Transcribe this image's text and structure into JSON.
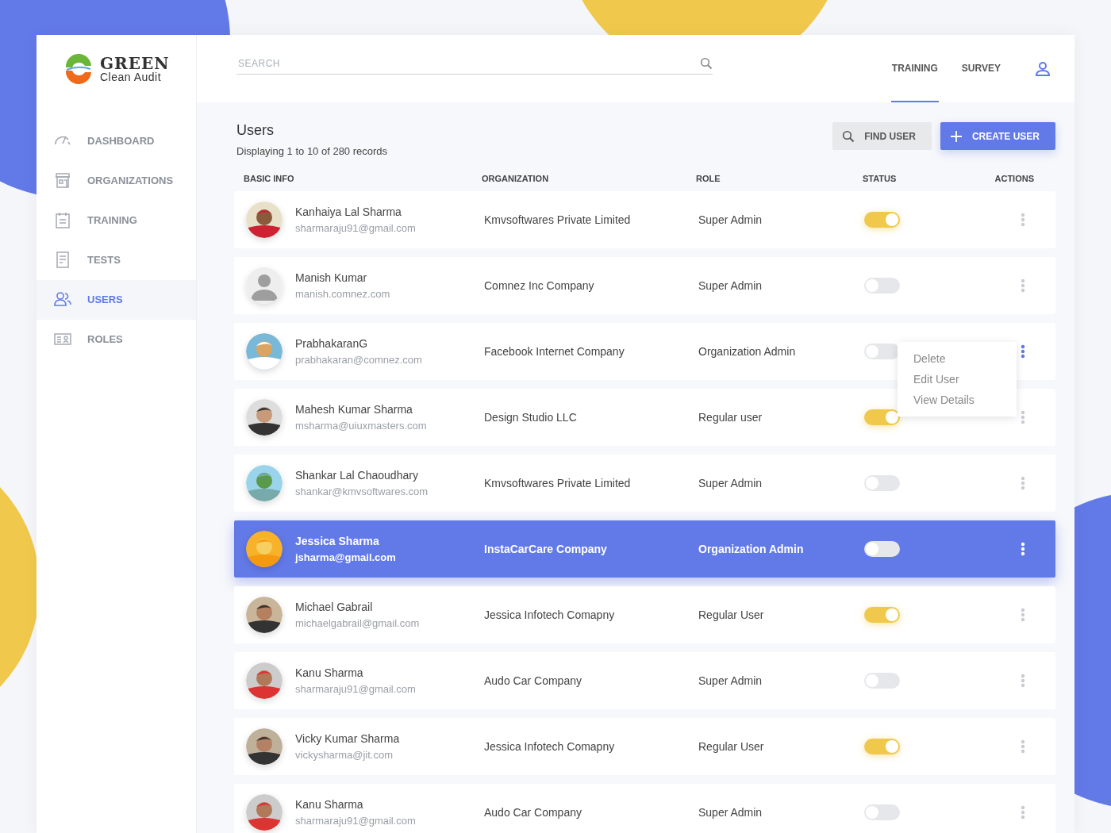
{
  "logo": {
    "title": "GREEN",
    "subtitle": "Clean Audit"
  },
  "sidebar": {
    "items": [
      {
        "label": "DASHBOARD",
        "selected": false
      },
      {
        "label": "ORGANIZATIONS",
        "selected": false
      },
      {
        "label": "TRAINING",
        "selected": false
      },
      {
        "label": "TESTS",
        "selected": false
      },
      {
        "label": "USERS",
        "selected": true
      },
      {
        "label": "ROLES",
        "selected": false
      }
    ]
  },
  "header": {
    "search": {
      "placeholder": "SEARCH"
    },
    "nav": [
      {
        "label": "TRAINING",
        "selected": true
      },
      {
        "label": "SURVEY",
        "selected": false
      }
    ]
  },
  "page": {
    "title": "Users",
    "subtitle": "Displaying 1 to 10 of 280 records",
    "buttons": [
      {
        "label": "FIND USER",
        "kind": "secondary"
      },
      {
        "label": "CREATE USER",
        "kind": "primary"
      }
    ]
  },
  "table": {
    "columns": [
      "BASIC INFO",
      "ORGANIZATION",
      "ROLE",
      "STATUS",
      "ACTIONS"
    ],
    "rows": [
      {
        "name": "Kanhaiya Lal Sharma",
        "email": "sharmaraju91@gmail.com",
        "organization": "Kmvsoftwares Private Limited",
        "role": "Super Admin",
        "active": true,
        "selected": false,
        "menu_open": false,
        "kind": "picture"
      },
      {
        "name": "Manish Kumar",
        "email": "manish.comnez.com",
        "organization": "Comnez Inc Company",
        "role": "Super Admin",
        "active": false,
        "selected": false,
        "menu_open": false,
        "kind": "silhouette"
      },
      {
        "name": "PrabhakaranG",
        "email": "prabhakaran@comnez.com",
        "organization": "Facebook Internet Company",
        "role": "Organization Admin",
        "active": false,
        "selected": false,
        "menu_open": true,
        "kind": "picture"
      },
      {
        "name": "Mahesh Kumar Sharma",
        "email": "msharma@uiuxmasters.com",
        "organization": "Design Studio LLC",
        "role": "Regular user",
        "active": true,
        "selected": false,
        "menu_open": false,
        "kind": "picture"
      },
      {
        "name": "Shankar Lal Chaoudhary",
        "email": "shankar@kmvsoftwares.com",
        "organization": "Kmvsoftwares Private Limited",
        "role": "Super Admin",
        "active": false,
        "selected": false,
        "menu_open": false,
        "kind": "picture"
      },
      {
        "name": "Jessica Sharma",
        "email": "jsharma@gmail.com",
        "organization": "InstaCarCare Company",
        "role": "Organization Admin",
        "active": false,
        "selected": true,
        "menu_open": false,
        "kind": "picture"
      },
      {
        "name": "Michael Gabrail",
        "email": "michaelgabrail@gmail.com",
        "organization": "Jessica Infotech Comapny",
        "role": "Regular User",
        "active": true,
        "selected": false,
        "menu_open": false,
        "kind": "picture"
      },
      {
        "name": "Kanu Sharma",
        "email": "sharmaraju91@gmail.com",
        "organization": "Audo Car Company",
        "role": "Super Admin",
        "active": false,
        "selected": false,
        "menu_open": false,
        "kind": "picture"
      },
      {
        "name": "Vicky Kumar Sharma",
        "email": "vickysharma@jit.com",
        "organization": "Jessica Infotech Comapny",
        "role": "Regular User",
        "active": true,
        "selected": false,
        "menu_open": false,
        "kind": "picture"
      },
      {
        "name": "Kanu Sharma",
        "email": "sharmaraju91@gmail.com",
        "organization": "Audo Car Company",
        "role": "Super Admin",
        "active": false,
        "selected": false,
        "menu_open": false,
        "kind": "picture"
      }
    ]
  },
  "action_menu": {
    "items": [
      "Delete",
      "Edit User",
      "View Details"
    ]
  }
}
